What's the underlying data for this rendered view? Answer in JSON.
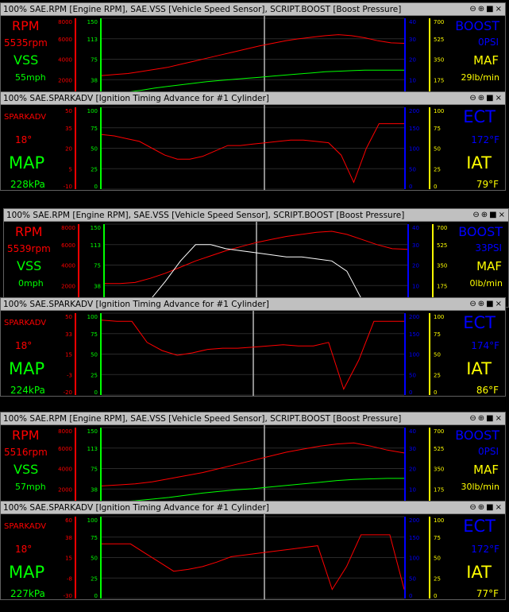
{
  "controls": {
    "minimize": "⊖",
    "maximize": "⊕",
    "restore": "■",
    "close": "×"
  },
  "rpm_panels": [
    {
      "title": "100% SAE.RPM [Engine RPM], SAE.VSS [Vehicle Speed Sensor], SCRIPT.BOOST [Boost Pressure]",
      "left_top_label": "RPM",
      "left_top_value": "5535rpm",
      "left_bottom_label": "VSS",
      "left_bottom_value": "55mph",
      "right_top_label": "BOOST",
      "right_top_value": "0PSI",
      "right_bottom_label": "MAF",
      "right_bottom_value": "29lb/min"
    },
    {
      "title": "100% SAE.RPM [Engine RPM], SAE.VSS [Vehicle Speed Sensor], SCRIPT.BOOST [Boost Pressure]",
      "left_top_label": "RPM",
      "left_top_value": "5539rpm",
      "left_bottom_label": "VSS",
      "left_bottom_value": "0mph",
      "right_top_label": "BOOST",
      "right_top_value": "33PSI",
      "right_bottom_label": "MAF",
      "right_bottom_value": "0lb/min"
    },
    {
      "title": "100% SAE.RPM [Engine RPM], SAE.VSS [Vehicle Speed Sensor], SCRIPT.BOOST [Boost Pressure]",
      "left_top_label": "RPM",
      "left_top_value": "5516rpm",
      "left_bottom_label": "VSS",
      "left_bottom_value": "57mph",
      "right_top_label": "BOOST",
      "right_top_value": "0PSI",
      "right_bottom_label": "MAF",
      "right_bottom_value": "30lb/min"
    }
  ],
  "spark_panels": [
    {
      "title": "100% SAE.SPARKADV [Ignition Timing Advance for #1 Cylinder]",
      "left_top_label": "SPARKADV",
      "left_top_value": "18°",
      "left_bottom_label": "MAP",
      "left_bottom_value": "228kPa",
      "right_top_label": "ECT",
      "right_top_value": "172°F",
      "right_bottom_label": "IAT",
      "right_bottom_value": "79°F"
    },
    {
      "title": "100% SAE.SPARKADV [Ignition Timing Advance for #1 Cylinder]",
      "left_top_label": "SPARKADV",
      "left_top_value": "18°",
      "left_bottom_label": "MAP",
      "left_bottom_value": "224kPa",
      "right_top_label": "ECT",
      "right_top_value": "174°F",
      "right_bottom_label": "IAT",
      "right_bottom_value": "86°F"
    },
    {
      "title": "100% SAE.SPARKADV [Ignition Timing Advance for #1 Cylinder]",
      "left_top_label": "SPARKADV",
      "left_top_value": "18°",
      "left_bottom_label": "MAP",
      "left_bottom_value": "227kPa",
      "right_top_label": "ECT",
      "right_top_value": "172°F",
      "right_bottom_label": "IAT",
      "right_bottom_value": "77°F"
    }
  ],
  "rpm_scales": {
    "red": [
      "8000",
      "6000",
      "4000",
      "2000",
      "0"
    ],
    "green": [
      "150",
      "113",
      "75",
      "38",
      "0"
    ],
    "blue": [
      "40",
      "30",
      "20",
      "10",
      "0"
    ],
    "yellow": [
      "700",
      "525",
      "350",
      "175",
      "0"
    ]
  },
  "spark_scales": [
    {
      "red": [
        "50",
        "35",
        "20",
        "5",
        "-10"
      ],
      "green": [
        "100",
        "75",
        "50",
        "25",
        "0"
      ],
      "blue": [
        "200",
        "150",
        "100",
        "50",
        "0"
      ],
      "yellow": [
        "100",
        "75",
        "50",
        "25",
        "0"
      ]
    },
    {
      "red": [
        "50",
        "33",
        "15",
        "-3",
        "-20"
      ],
      "green": [
        "100",
        "75",
        "50",
        "25",
        "0"
      ],
      "blue": [
        "200",
        "150",
        "100",
        "50",
        "0"
      ],
      "yellow": [
        "100",
        "75",
        "50",
        "25",
        "0"
      ]
    },
    {
      "red": [
        "60",
        "38",
        "15",
        "-8",
        "-30"
      ],
      "green": [
        "100",
        "75",
        "50",
        "25",
        "0"
      ],
      "blue": [
        "200",
        "150",
        "100",
        "50",
        "0"
      ],
      "yellow": [
        "100",
        "75",
        "50",
        "25",
        "0"
      ]
    }
  ],
  "colors": {
    "red": "#ff0000",
    "green": "#00c000",
    "bright_green": "#00ff00",
    "blue": "#0000ff",
    "yellow": "#ffff00",
    "white": "#ffffff",
    "titlebar": "#c0c0c0"
  },
  "chart_data": [
    {
      "type": "line",
      "panel": 1,
      "series": [
        {
          "name": "RPM",
          "color": "#ff0000",
          "values": [
            2400,
            2500,
            2600,
            2800,
            3000,
            3200,
            3500,
            3800,
            4100,
            4400,
            4700,
            5000,
            5300,
            5550,
            5800,
            6000,
            6150,
            6300,
            6400,
            6300,
            6100,
            5800,
            5600,
            5550
          ]
        },
        {
          "name": "VSS",
          "color": "#00ff00",
          "values": [
            10,
            12,
            15,
            18,
            22,
            25,
            28,
            31,
            34,
            36,
            38,
            40,
            42,
            44,
            46,
            48,
            50,
            52,
            53,
            54,
            55,
            55,
            55,
            55
          ]
        }
      ]
    },
    {
      "type": "line",
      "panel": 2,
      "series": [
        {
          "name": "SPARKADV",
          "color": "#ff0000",
          "values": [
            30,
            29,
            27,
            25,
            20,
            15,
            12,
            12,
            14,
            18,
            22,
            22,
            23,
            24,
            25,
            26,
            26,
            25,
            24,
            15,
            -5,
            20,
            38,
            38,
            38
          ]
        }
      ]
    },
    {
      "type": "line",
      "panel": 3,
      "series": [
        {
          "name": "RPM",
          "color": "#ff0000",
          "values": [
            2200,
            2200,
            2300,
            2700,
            3200,
            3800,
            4400,
            4900,
            5400,
            5800,
            6200,
            6500,
            6800,
            7000,
            7200,
            7300,
            7000,
            6500,
            6000,
            5600,
            5540
          ]
        },
        {
          "name": "Boost",
          "color": "#ffffff",
          "values": [
            3,
            3,
            3,
            3,
            12,
            22,
            30,
            30,
            28,
            27,
            26,
            25,
            24,
            24,
            23,
            22,
            17,
            3,
            2,
            2,
            2
          ]
        }
      ]
    },
    {
      "type": "line",
      "panel": 4,
      "series": [
        {
          "name": "SPARKADV",
          "color": "#ff0000",
          "values": [
            44,
            43,
            43,
            25,
            18,
            14,
            16,
            19,
            20,
            20,
            21,
            22,
            23,
            22,
            22,
            25,
            -15,
            10,
            43,
            43,
            43
          ]
        }
      ]
    },
    {
      "type": "line",
      "panel": 5,
      "series": [
        {
          "name": "RPM",
          "color": "#ff0000",
          "values": [
            2300,
            2400,
            2500,
            2700,
            3000,
            3300,
            3600,
            4000,
            4400,
            4800,
            5200,
            5600,
            5900,
            6200,
            6400,
            6500,
            6200,
            5800,
            5520
          ]
        },
        {
          "name": "VSS",
          "color": "#00ff00",
          "values": [
            12,
            14,
            16,
            19,
            22,
            26,
            30,
            33,
            36,
            38,
            41,
            44,
            47,
            50,
            53,
            55,
            56,
            57,
            57
          ]
        }
      ]
    },
    {
      "type": "line",
      "panel": 6,
      "series": [
        {
          "name": "SPARKADV",
          "color": "#ff0000",
          "values": [
            30,
            30,
            30,
            20,
            10,
            0,
            2,
            5,
            10,
            16,
            18,
            20,
            22,
            24,
            26,
            28,
            -20,
            5,
            40,
            40,
            40,
            -20
          ]
        }
      ]
    }
  ]
}
